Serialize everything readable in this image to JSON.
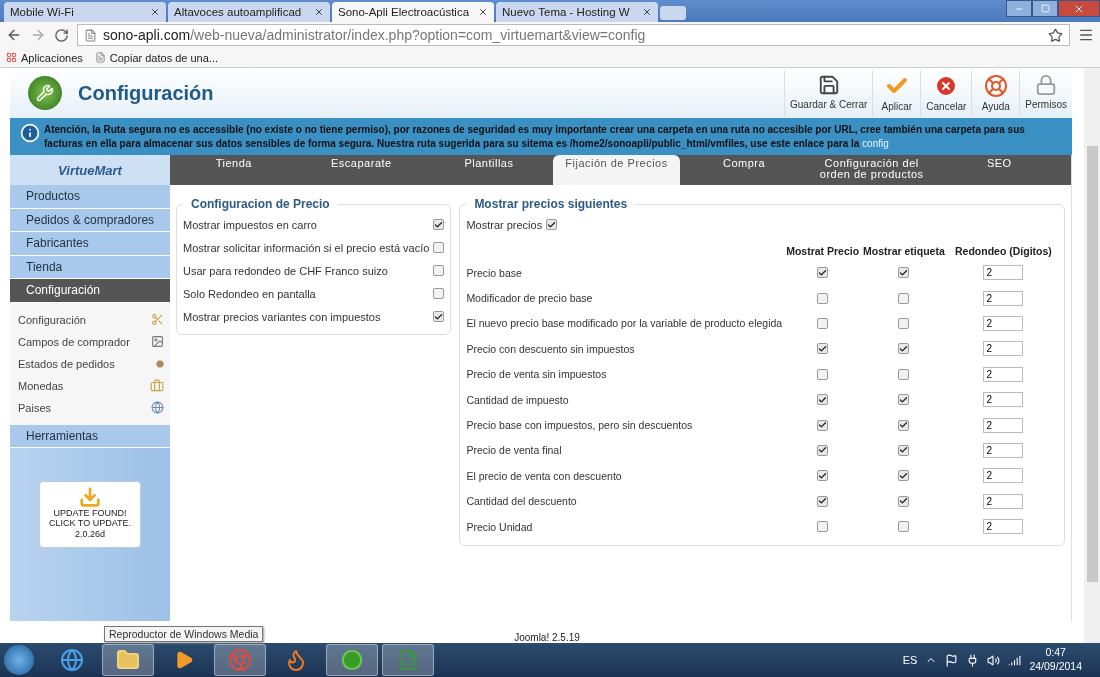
{
  "browser": {
    "tabs": [
      {
        "title": "Mobile Wi-Fi",
        "selected": false
      },
      {
        "title": "Altavoces autoamplificad",
        "selected": false
      },
      {
        "title": "Sono-Apli Electroacústica",
        "selected": true
      },
      {
        "title": "Nuevo Tema - Hosting W",
        "selected": false
      }
    ],
    "address_prefix": "sono-apli.com",
    "address_rest": "/web-nueva/administrator/index.php?option=com_virtuemart&view=config",
    "bookmarks": [
      "Aplicaciones",
      "Copiar datos de una..."
    ]
  },
  "header": {
    "title": "Configuración",
    "buttons": [
      {
        "label": "Guardar & Cerrar",
        "kind": "save"
      },
      {
        "label": "Aplicar",
        "kind": "apply"
      },
      {
        "label": "Cancelar",
        "kind": "cancel"
      },
      {
        "label": "Ayuda",
        "kind": "help"
      },
      {
        "label": "Permisos",
        "kind": "permissions"
      }
    ]
  },
  "notice": {
    "text": "**Atención, la Ruta segura no es accessible (no existe o no tiene permiso), por razones de seguridad es muy importante crear una carpeta en una ruta no accesible por URL, cree también una carpeta para sus facturas en ella para almacenar sus datos sensibles de forma segura. Nuestra ruta sugerida para su sitema es /home2/sonoapli/public_html/vmfiles, use este enlace para la**",
    "link": "config"
  },
  "sidebar": {
    "logo": "VirtueMart",
    "menu": [
      {
        "label": "Productos",
        "selected": false
      },
      {
        "label": "Pedidos & compradores",
        "selected": false
      },
      {
        "label": "Fabricantes",
        "selected": false
      },
      {
        "label": "Tienda",
        "selected": false
      },
      {
        "label": "Configuración",
        "selected": true
      }
    ],
    "submenu": [
      {
        "label": "Configuración",
        "kind": "tools"
      },
      {
        "label": "Campos de comprador",
        "kind": "image"
      },
      {
        "label": "Estados de pedidos",
        "kind": "dot"
      },
      {
        "label": "Monedas",
        "kind": "coins"
      },
      {
        "label": "Paises",
        "kind": "globe"
      }
    ],
    "tools": "Herramientas",
    "update": [
      "UPDATE FOUND!",
      "CLICK TO UPDATE.",
      "2.0.26d"
    ]
  },
  "tabs": [
    {
      "label": "Tienda",
      "selected": false
    },
    {
      "label": "Escaparate",
      "selected": false
    },
    {
      "label": "Plantillas",
      "selected": false
    },
    {
      "label": "Fijación de Precios",
      "selected": true
    },
    {
      "label": "Compra",
      "selected": false
    },
    {
      "label": "Configuración del orden de productos",
      "selected": false
    },
    {
      "label": "SEO",
      "selected": false
    }
  ],
  "price_config": {
    "title": "Configuracion de Precio",
    "options": [
      {
        "label": "Mostrar impuestos en carro",
        "checked": true
      },
      {
        "label": "Mostrar solicitar información si el precio está vacío",
        "checked": false
      },
      {
        "label": "Usar para redondeo de CHF Franco suizo",
        "checked": false
      },
      {
        "label": "Solo Redondeo en pantalla",
        "checked": false
      },
      {
        "label": "Mostrar precios variantes con impuestos",
        "checked": true
      }
    ]
  },
  "show_prices": {
    "title": "Mostrar precios siguientes",
    "show": {
      "label": "Mostrar precios",
      "checked": true
    },
    "columns": [
      "Mostrat Precio",
      "Mostrar etiqueta",
      "Redondeo (Dígitos)"
    ],
    "rows": [
      {
        "label": "Precio base",
        "show_price": true,
        "show_label": true,
        "rounding": "2"
      },
      {
        "label": "Modificador de precio base",
        "show_price": false,
        "show_label": false,
        "rounding": "2"
      },
      {
        "label": "El nuevo precio base modificado por la variable de producto elegida",
        "show_price": false,
        "show_label": false,
        "rounding": "2"
      },
      {
        "label": "Precio con descuento sin impuestos",
        "show_price": true,
        "show_label": true,
        "rounding": "2"
      },
      {
        "label": "Precio de venta sin impuestos",
        "show_price": false,
        "show_label": false,
        "rounding": "2"
      },
      {
        "label": "Cantidad de impuesto",
        "show_price": true,
        "show_label": true,
        "rounding": "2"
      },
      {
        "label": "Precio base con impuestos, pero sin descuentos",
        "show_price": true,
        "show_label": true,
        "rounding": "2"
      },
      {
        "label": "Precio de venta final",
        "show_price": true,
        "show_label": true,
        "rounding": "2"
      },
      {
        "label": "El precio de venta con descuento",
        "show_price": true,
        "show_label": true,
        "rounding": "2"
      },
      {
        "label": "Cantidad del descuento",
        "show_price": true,
        "show_label": true,
        "rounding": "2"
      },
      {
        "label": "Precio Unidad",
        "show_price": false,
        "show_label": false,
        "rounding": "2"
      }
    ]
  },
  "footer": "Joomla! 2.5.19",
  "taskbar": {
    "tooltip": "Reproductor de Windows Media",
    "language": "ES",
    "time": "0:47",
    "date": "24/09/2014"
  }
}
